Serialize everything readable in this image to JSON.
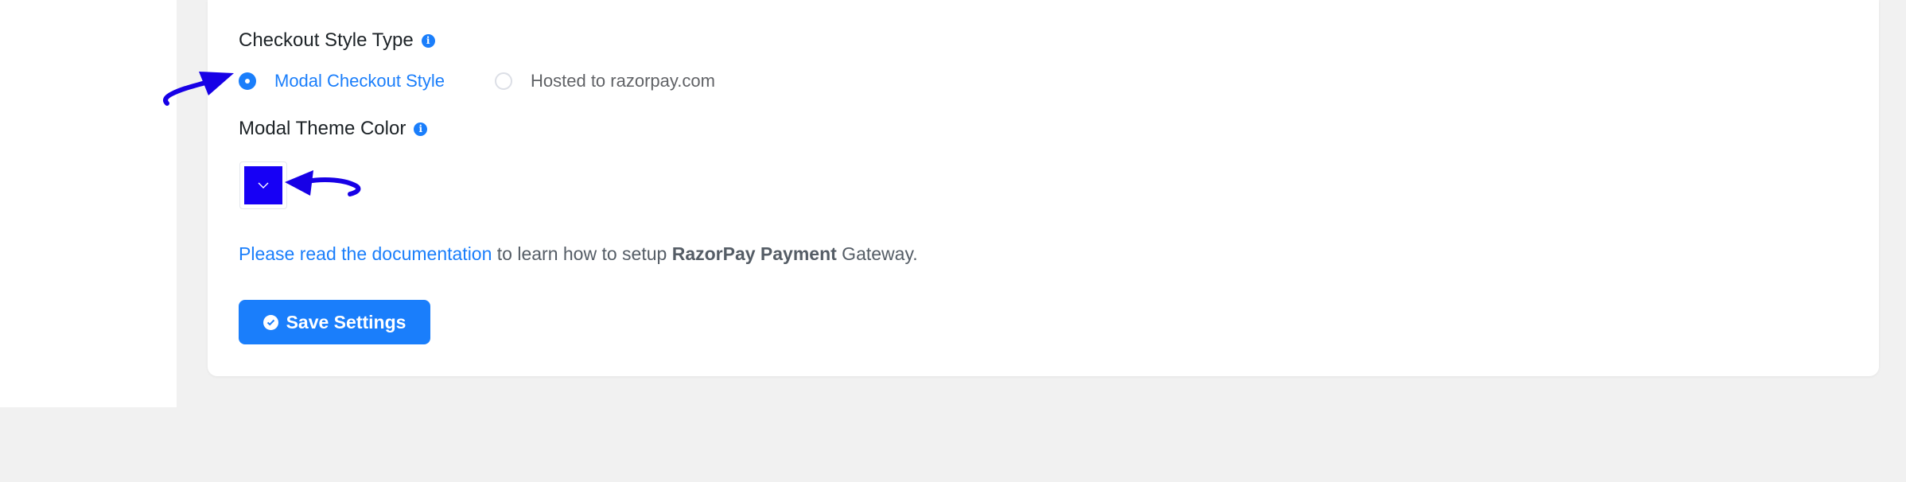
{
  "checkout_style": {
    "label": "Checkout Style Type",
    "options": [
      {
        "label": "Modal Checkout Style",
        "selected": true
      },
      {
        "label": "Hosted to razorpay.com",
        "selected": false
      }
    ]
  },
  "theme_color": {
    "label": "Modal Theme Color",
    "value": "#1700f5"
  },
  "documentation": {
    "link_text": "Please read the documentation",
    "middle_text": " to learn how to setup ",
    "bold_text": "RazorPay Payment",
    "end_text": " Gateway."
  },
  "save_button": {
    "label": "Save Settings"
  },
  "icons": {
    "info": "info-icon",
    "check": "check-circle-icon",
    "dropdown": "chevron-down-icon",
    "annotation": "arrow-annotation"
  },
  "colors": {
    "accent": "#1a7efb",
    "annotation_arrow": "#1700e6"
  }
}
